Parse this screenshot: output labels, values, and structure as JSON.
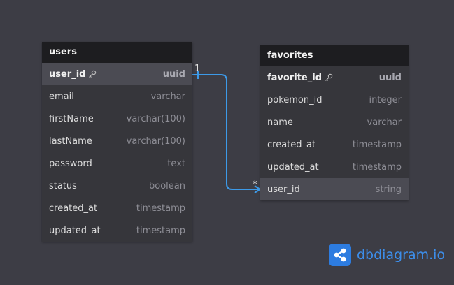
{
  "users": {
    "title": "users",
    "columns": [
      {
        "name": "user_id",
        "type": "uuid",
        "pk": true
      },
      {
        "name": "email",
        "type": "varchar"
      },
      {
        "name": "firstName",
        "type": "varchar(100)"
      },
      {
        "name": "lastName",
        "type": "varchar(100)"
      },
      {
        "name": "password",
        "type": "text"
      },
      {
        "name": "status",
        "type": "boolean"
      },
      {
        "name": "created_at",
        "type": "timestamp"
      },
      {
        "name": "updated_at",
        "type": "timestamp"
      }
    ]
  },
  "favorites": {
    "title": "favorites",
    "columns": [
      {
        "name": "favorite_id",
        "type": "uuid",
        "pk": true
      },
      {
        "name": "pokemon_id",
        "type": "integer"
      },
      {
        "name": "name",
        "type": "varchar"
      },
      {
        "name": "created_at",
        "type": "timestamp"
      },
      {
        "name": "updated_at",
        "type": "timestamp"
      },
      {
        "name": "user_id",
        "type": "string"
      }
    ]
  },
  "relationship": {
    "from_label": "1",
    "to_label": "*",
    "color": "#3d9ae8"
  },
  "brand": {
    "text": "dbdiagram.io",
    "color": "#3d8eea",
    "icon": "share-nodes-icon"
  }
}
